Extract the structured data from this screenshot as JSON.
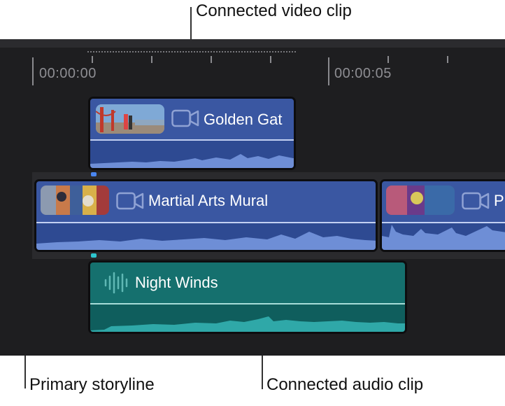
{
  "callouts": {
    "connected_video": "Connected video clip",
    "primary_storyline": "Primary storyline",
    "connected_audio": "Connected audio clip"
  },
  "ruler": {
    "timecode_start": "00:00:00",
    "timecode_5s": "00:00:05"
  },
  "clips": {
    "golden_gate": {
      "title": "Golden Gat",
      "type": "video",
      "icon": "video-camera-icon"
    },
    "martial_arts": {
      "title": "Martial Arts Mural",
      "type": "video",
      "icon": "video-camera-icon"
    },
    "next_clip": {
      "title": "P",
      "type": "video",
      "icon": "video-camera-icon"
    },
    "night_winds": {
      "title": "Night Winds",
      "type": "audio",
      "icon": "audio-waveform-icon"
    }
  },
  "colors": {
    "video_clip": "#3a57a2",
    "audio_clip": "#15706e",
    "timeline_bg": "#1e1e20",
    "connection_marker_video": "#4a86f0",
    "connection_marker_audio": "#2ec6cf"
  }
}
